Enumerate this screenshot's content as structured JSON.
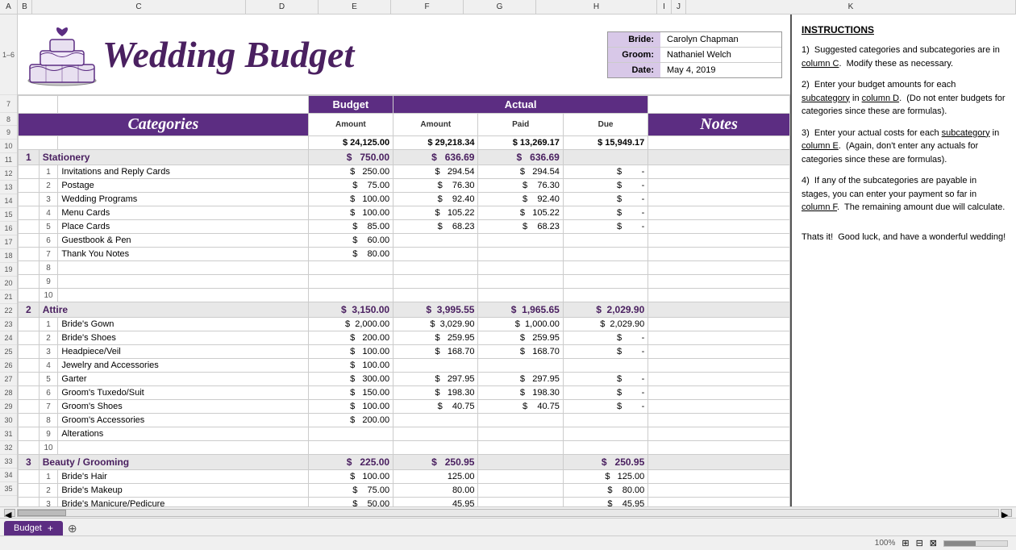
{
  "title": "Wedding Budget",
  "bride": "Carolyn Chapman",
  "groom": "Nathaniel Welch",
  "date": "May 4, 2019",
  "labels": {
    "bride": "Bride:",
    "groom": "Groom:",
    "date": "Date:",
    "budget": "Budget",
    "actual": "Actual",
    "categories": "Categories",
    "notes": "Notes",
    "amount": "Amount",
    "paid": "Paid",
    "due": "Due",
    "tab": "Budget"
  },
  "totals": {
    "budget_amount": "$ 24,125.00",
    "actual_amount": "$ 29,218.34",
    "actual_paid": "$ 13,269.17",
    "actual_due": "$ 15,949.17"
  },
  "categories": [
    {
      "num": "1",
      "name": "Stationery",
      "budget": "$ 750.00",
      "actual": "$ 636.69",
      "paid": "$ 636.69",
      "due": "",
      "items": [
        {
          "num": "1",
          "name": "Invitations and Reply Cards",
          "budget": "$ 250.00",
          "actual": "$ 294.54",
          "paid": "$ 294.54",
          "due": "$ -"
        },
        {
          "num": "2",
          "name": "Postage",
          "budget": "$ 75.00",
          "actual": "$ 76.30",
          "paid": "$ 76.30",
          "due": "$ -"
        },
        {
          "num": "3",
          "name": "Wedding Programs",
          "budget": "$ 100.00",
          "actual": "$ 92.40",
          "paid": "$ 92.40",
          "due": "$ -"
        },
        {
          "num": "4",
          "name": "Menu Cards",
          "budget": "$ 100.00",
          "actual": "$ 105.22",
          "paid": "$ 105.22",
          "due": "$ -"
        },
        {
          "num": "5",
          "name": "Place Cards",
          "budget": "$ 85.00",
          "actual": "$ 68.23",
          "paid": "$ 68.23",
          "due": "$ -"
        },
        {
          "num": "6",
          "name": "Guestbook & Pen",
          "budget": "$ 60.00",
          "actual": "",
          "paid": "",
          "due": ""
        },
        {
          "num": "7",
          "name": "Thank You Notes",
          "budget": "$ 80.00",
          "actual": "",
          "paid": "",
          "due": ""
        },
        {
          "num": "8",
          "name": "",
          "budget": "",
          "actual": "",
          "paid": "",
          "due": ""
        },
        {
          "num": "9",
          "name": "",
          "budget": "",
          "actual": "",
          "paid": "",
          "due": ""
        },
        {
          "num": "10",
          "name": "",
          "budget": "",
          "actual": "",
          "paid": "",
          "due": ""
        }
      ]
    },
    {
      "num": "2",
      "name": "Attire",
      "budget": "$ 3,150.00",
      "actual": "$ 3,995.55",
      "paid": "$ 1,965.65",
      "due": "$ 2,029.90",
      "items": [
        {
          "num": "1",
          "name": "Bride's Gown",
          "budget": "$ 2,000.00",
          "actual": "$ 3,029.90",
          "paid": "$ 1,000.00",
          "due": "$ 2,029.90"
        },
        {
          "num": "2",
          "name": "Bride's Shoes",
          "budget": "$ 200.00",
          "actual": "$ 259.95",
          "paid": "$ 259.95",
          "due": "$ -"
        },
        {
          "num": "3",
          "name": "Headpiece/Veil",
          "budget": "$ 100.00",
          "actual": "$ 168.70",
          "paid": "$ 168.70",
          "due": "$ -"
        },
        {
          "num": "4",
          "name": "Jewelry and Accessories",
          "budget": "$ 100.00",
          "actual": "",
          "paid": "",
          "due": ""
        },
        {
          "num": "5",
          "name": "Garter",
          "budget": "$ 300.00",
          "actual": "$ 297.95",
          "paid": "$ 297.95",
          "due": "$ -"
        },
        {
          "num": "6",
          "name": "Groom's Tuxedo/Suit",
          "budget": "$ 150.00",
          "actual": "$ 198.30",
          "paid": "$ 198.30",
          "due": "$ -"
        },
        {
          "num": "7",
          "name": "Groom's Shoes",
          "budget": "$ 100.00",
          "actual": "$ 40.75",
          "paid": "$ 40.75",
          "due": "$ -"
        },
        {
          "num": "8",
          "name": "Groom's Accessories",
          "budget": "$ 200.00",
          "actual": "",
          "paid": "",
          "due": ""
        },
        {
          "num": "9",
          "name": "Alterations",
          "budget": "",
          "actual": "",
          "paid": "",
          "due": ""
        },
        {
          "num": "10",
          "name": "",
          "budget": "",
          "actual": "",
          "paid": "",
          "due": ""
        }
      ]
    },
    {
      "num": "3",
      "name": "Beauty / Grooming",
      "budget": "$ 225.00",
      "actual": "$ 250.95",
      "paid": "",
      "due": "$ 250.95",
      "items": [
        {
          "num": "1",
          "name": "Bride's Hair",
          "budget": "$ 100.00",
          "actual": "125.00",
          "paid": "",
          "due": "$ 125.00"
        },
        {
          "num": "2",
          "name": "Bride's Makeup",
          "budget": "$ 75.00",
          "actual": "80.00",
          "paid": "",
          "due": "$ 80.00"
        },
        {
          "num": "3",
          "name": "Bride's Manicure/Pedicure",
          "budget": "$ 50.00",
          "actual": "45.95",
          "paid": "",
          "due": "$ 45.95"
        }
      ]
    }
  ],
  "instructions": {
    "title": "INSTRUCTIONS",
    "items": [
      "Suggested categories and subcategories are in column C.  Modify these as necessary.",
      "Enter your budget amounts for each subcategory in column D.  (Do not enter budgets for categories since these are formulas).",
      "Enter your actual costs for each subcategory in column E.  (Again, don't enter any actuals for categories since these are formulas).",
      "If any of the subcategories are payable in stages, you can enter your payment so far in column F.  The remaining amount due will calculate.",
      "Thats it!  Good luck, and have a wonderful wedding!"
    ]
  }
}
